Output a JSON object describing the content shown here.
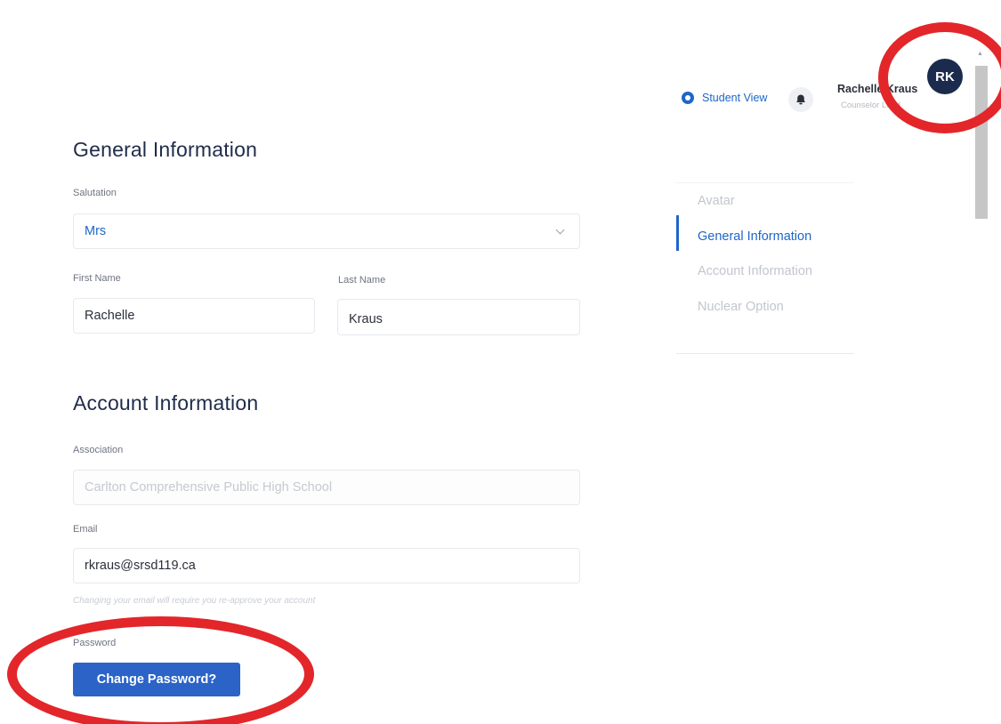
{
  "header": {
    "student_view_label": "Student View",
    "user_name": "Rachelle Kraus",
    "user_role": "Counselor Lead",
    "avatar_initials": "RK",
    "accent_color": "#1e66c8"
  },
  "general": {
    "heading": "General Information",
    "salutation_label": "Salutation",
    "salutation_value": "Mrs",
    "first_name_label": "First Name",
    "first_name_value": "Rachelle",
    "last_name_label": "Last Name",
    "last_name_value": "Kraus"
  },
  "account": {
    "heading": "Account Information",
    "association_label": "Association",
    "association_value": "Carlton Comprehensive Public High School",
    "email_label": "Email",
    "email_value": "rkraus@srsd119.ca",
    "email_hint": "Changing your email will require you re-approve your account",
    "password_label": "Password",
    "change_password_button": "Change Password?"
  },
  "sidenav": {
    "items": [
      {
        "label": "Avatar"
      },
      {
        "label": "General Information"
      },
      {
        "label": "Account Information"
      },
      {
        "label": "Nuclear Option"
      }
    ],
    "active_index": 1
  },
  "icons": {
    "eye": "eye-icon",
    "bell": "bell-icon",
    "chevron": "chevron-down-icon"
  },
  "annotations": {
    "color": "#e3262a"
  }
}
